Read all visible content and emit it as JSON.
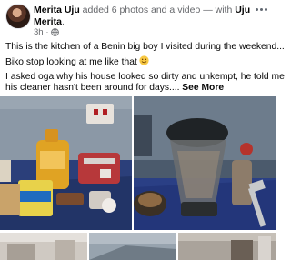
{
  "post": {
    "author": "Merita Uju",
    "action": " added 6 photos and a video — with ",
    "tagged_first": "Uju",
    "tagged_second": "Merita",
    "tagged_end": ".",
    "time": "3h",
    "privacy_icon": "globe-icon",
    "menu_icon": "more-options-icon",
    "caption": {
      "line1": "This is the kitchen of a Benin big boy I visited during the weekend...",
      "line2": "Biko stop looking at me like that",
      "line2_emoji": "smiling-emoji-icon",
      "line3": "I asked oga why his house looked so dirty and  unkempt, he told me",
      "line4": "his cleaner hasn't been around for days....",
      "see_more": " See More"
    },
    "photo_count": 6
  }
}
